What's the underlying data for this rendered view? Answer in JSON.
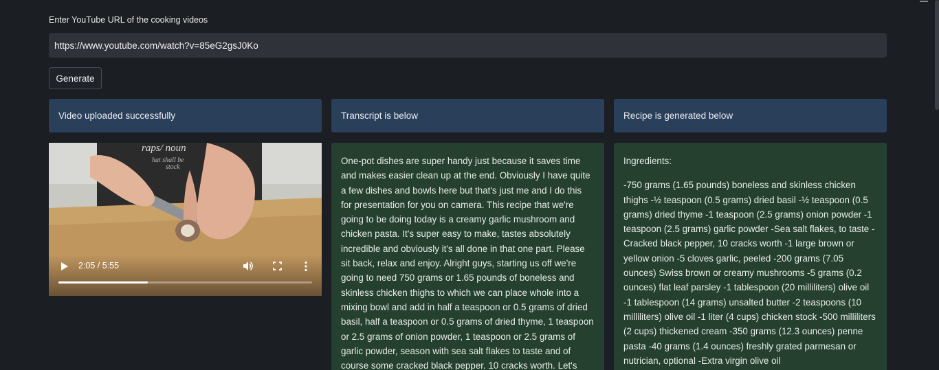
{
  "form": {
    "label": "Enter YouTube URL of the cooking videos",
    "url_value": "https://www.youtube.com/watch?v=85eG2gsJ0Ko",
    "generate_label": "Generate"
  },
  "columns": {
    "video_header": "Video uploaded successfully",
    "transcript_header": "Transcript is below",
    "recipe_header": "Recipe is generated below"
  },
  "video": {
    "time": "2:05 / 5:55",
    "progress_fraction": 0.353
  },
  "transcript": {
    "text": "One-pot dishes are super handy just because it saves time and makes easier clean up at the end. Obviously I have quite a few dishes and bowls here but that's just me and I do this for presentation for you on camera. This recipe that we're going to be doing today is a creamy garlic mushroom and chicken pasta. It's super easy to make, tastes absolutely incredible and obviously it's all done in that one part. Please sit back, relax and enjoy. Alright guys, starting us off we're going to need 750 grams or 1.65 pounds of boneless and skinless chicken thighs to which we can place whole into a mixing bowl and add in half a teaspoon or 0.5 grams of dried basil, half a teaspoon or 0.5 grams of dried thyme, 1 teaspoon or 2.5 grams of onion powder, 1 teaspoon or 2.5 grams of garlic powder, season with sea salt flakes to taste and of course some cracked black pepper. 10 cracks worth. Let's then get our hands in there to"
  },
  "recipe": {
    "ingredients_title": "Ingredients:",
    "ingredients_text": "-750 grams (1.65 pounds) boneless and skinless chicken thighs -½ teaspoon (0.5 grams) dried basil -½ teaspoon (0.5 grams) dried thyme -1 teaspoon (2.5 grams) onion powder -1 teaspoon (2.5 grams) garlic powder -Sea salt flakes, to taste -Cracked black pepper, 10 cracks worth -1 large brown or yellow onion -5 cloves garlic, peeled -200 grams (7.05 ounces) Swiss brown or creamy mushrooms -5 grams (0.2 ounces) flat leaf parsley -1 tablespoon (20 milliliters) olive oil -1 tablespoon (14 grams) unsalted butter -2 teaspoons (10 milliliters) olive oil -1 liter (4 cups) chicken stock -500 milliliters (2 cups) thickened cream -350 grams (12.3 ounces) penne pasta -40 grams (1.4 ounces) freshly grated parmesan or nutrician, optional -Extra virgin olive oil"
  },
  "colors": {
    "background": "#1b1e23",
    "header_blue": "#2a3f5a",
    "panel_green": "#25402f"
  }
}
